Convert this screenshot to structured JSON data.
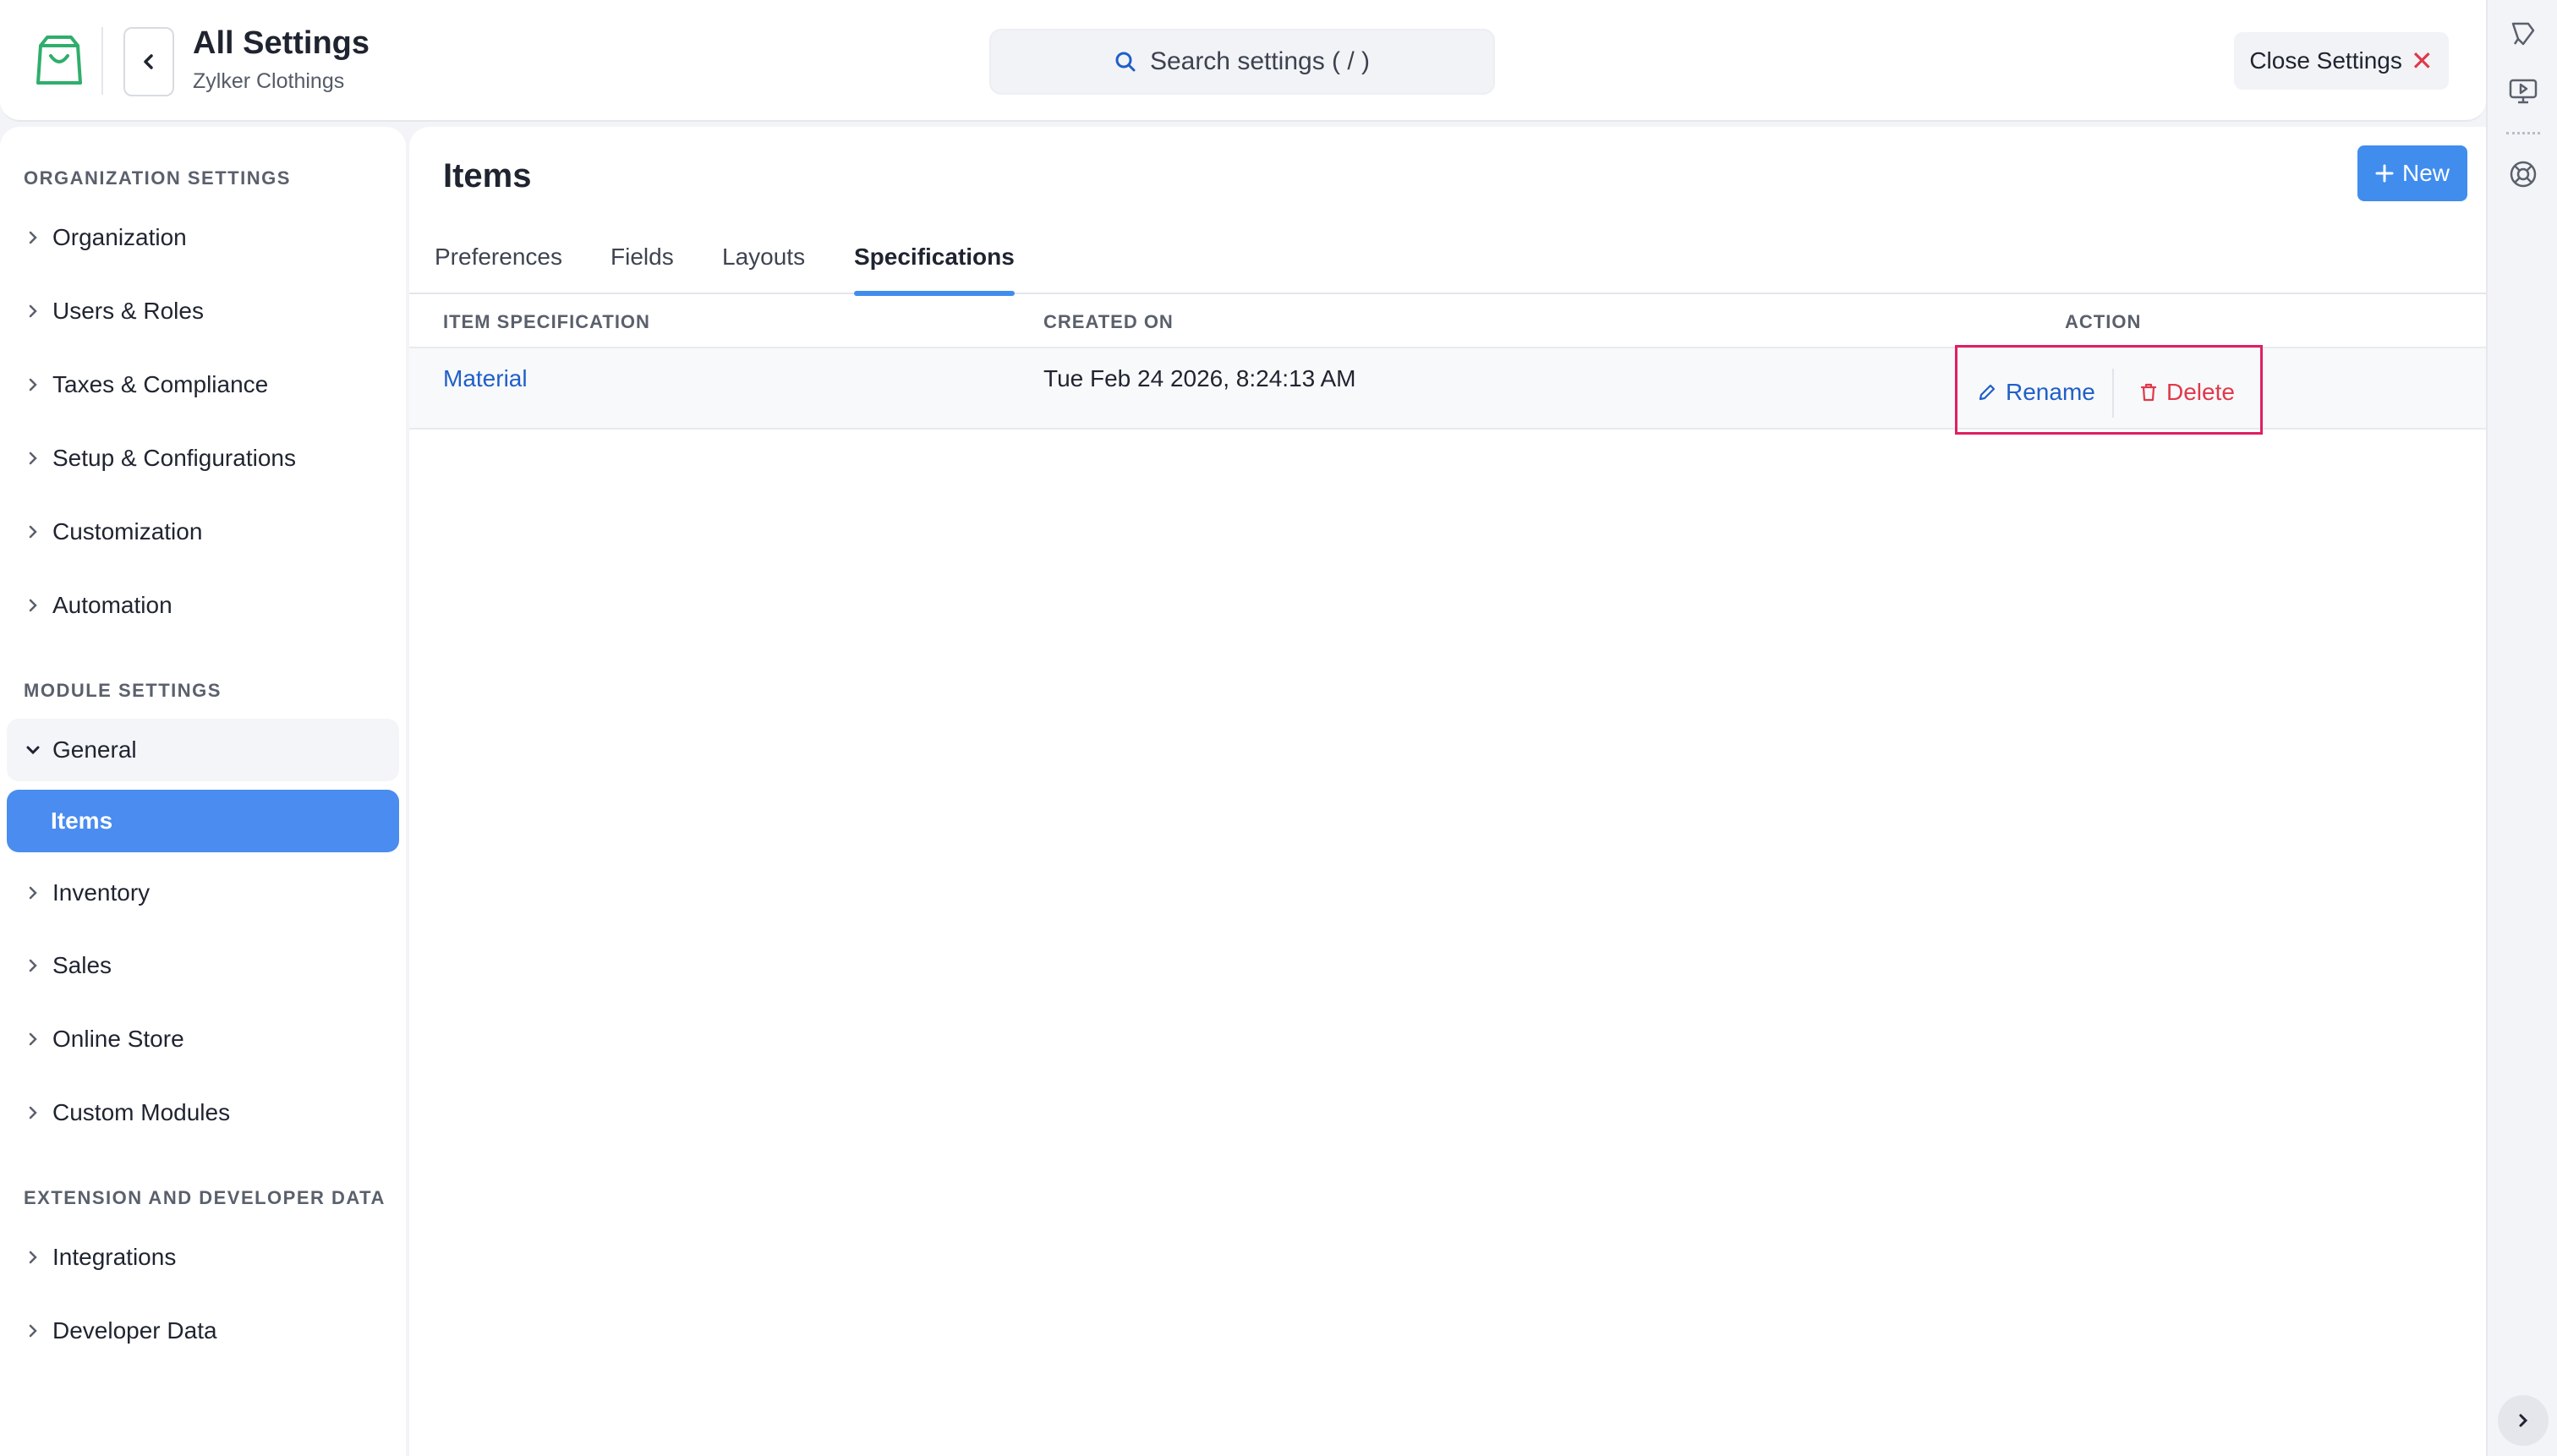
{
  "header": {
    "title": "All Settings",
    "subtitle": "Zylker Clothings",
    "search_placeholder": "Search settings ( / )",
    "close_label": "Close Settings"
  },
  "sidebar": {
    "org_section": "ORGANIZATION SETTINGS",
    "org_items": [
      "Organization",
      "Users & Roles",
      "Taxes & Compliance",
      "Setup & Configurations",
      "Customization",
      "Automation"
    ],
    "module_section": "MODULE SETTINGS",
    "general_label": "General",
    "active_item": "Items",
    "module_items": [
      "Inventory",
      "Sales",
      "Online Store",
      "Custom Modules"
    ],
    "ext_section": "EXTENSION AND DEVELOPER DATA",
    "ext_items": [
      "Integrations",
      "Developer Data"
    ]
  },
  "main": {
    "title": "Items",
    "new_label": "New",
    "tabs": [
      "Preferences",
      "Fields",
      "Layouts",
      "Specifications"
    ],
    "active_tab": "Specifications",
    "columns": [
      "ITEM SPECIFICATION",
      "CREATED ON",
      "ACTION"
    ],
    "rows": [
      {
        "name": "Material",
        "created_on": "Tue Feb 24 2026, 8:24:13 AM"
      }
    ],
    "actions": {
      "rename": "Rename",
      "delete": "Delete"
    }
  },
  "colors": {
    "accent": "#408dee",
    "link": "#1f5fc9",
    "danger": "#e0394a",
    "highlight": "#e01e63"
  }
}
